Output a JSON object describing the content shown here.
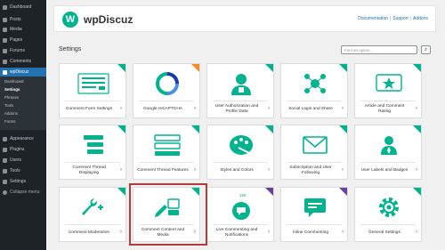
{
  "sidebar": {
    "items": [
      {
        "label": "Dashboard",
        "icon": "dashboard-icon"
      },
      {
        "label": "Posts",
        "icon": "pin-icon"
      },
      {
        "label": "Media",
        "icon": "media-icon"
      },
      {
        "label": "Pages",
        "icon": "page-icon"
      },
      {
        "label": "Forums",
        "icon": "forums-icon"
      },
      {
        "label": "Comments",
        "icon": "comment-icon"
      },
      {
        "label": "wpDiscuz",
        "icon": "wpdiscuz-icon"
      },
      {
        "label": "Appearance",
        "icon": "brush-icon"
      },
      {
        "label": "Plugins",
        "icon": "plug-icon"
      },
      {
        "label": "Users",
        "icon": "user-icon"
      },
      {
        "label": "Tools",
        "icon": "wrench-icon"
      },
      {
        "label": "Settings",
        "icon": "settings-icon"
      },
      {
        "label": "Collapse menu",
        "icon": "collapse-icon"
      }
    ],
    "submenu": [
      "Dashboard",
      "Settings",
      "Phrases",
      "Tools",
      "Addons",
      "Forms"
    ]
  },
  "header": {
    "logo_letter": "W",
    "brand": "wpDiscuz",
    "links": [
      "Documentation",
      "Support",
      "Addons"
    ]
  },
  "main": {
    "title": "Settings",
    "search_placeholder": "Find an option..."
  },
  "cards": [
    {
      "label": "Comment Form Settings",
      "icon": "form-icon",
      "badge": "green"
    },
    {
      "label": "Google reCAPTCHA",
      "icon": "recaptcha-icon",
      "badge": "orange"
    },
    {
      "label": "User Authorization and Profile Data",
      "icon": "user-profile-icon",
      "badge": "green"
    },
    {
      "label": "Social Login and Share",
      "icon": "social-network-icon",
      "badge": "green"
    },
    {
      "label": "Article and Comment Rating",
      "icon": "star-rating-icon",
      "badge": "green"
    },
    {
      "label": "Comment Thread Displaying",
      "icon": "thread-icon",
      "badge": "green"
    },
    {
      "label": "Comment Thread Features",
      "icon": "thread-features-icon",
      "badge": "green"
    },
    {
      "label": "Styles and Colors",
      "icon": "palette-icon",
      "badge": "green"
    },
    {
      "label": "Subscription and User Following",
      "icon": "envelope-icon",
      "badge": "green"
    },
    {
      "label": "User Labels and Badges",
      "icon": "badge-icon",
      "badge": "green"
    },
    {
      "label": "Comment Moderation",
      "icon": "wrench-moderation-icon",
      "badge": "green"
    },
    {
      "label": "Comment Content and Media",
      "icon": "content-media-icon",
      "badge": "green"
    },
    {
      "label": "Live Commenting and Notifications",
      "icon": "live-chat-icon",
      "badge": "purple",
      "count": "195"
    },
    {
      "label": "Inline Commenting",
      "icon": "inline-comment-icon",
      "badge": "purple"
    },
    {
      "label": "General Settings",
      "icon": "gear-icon",
      "badge": "green"
    }
  ],
  "colors": {
    "accent": "#00b38f",
    "sidebar_bg": "#1d2327",
    "active": "#2271b1",
    "highlight": "#b33a3a"
  }
}
